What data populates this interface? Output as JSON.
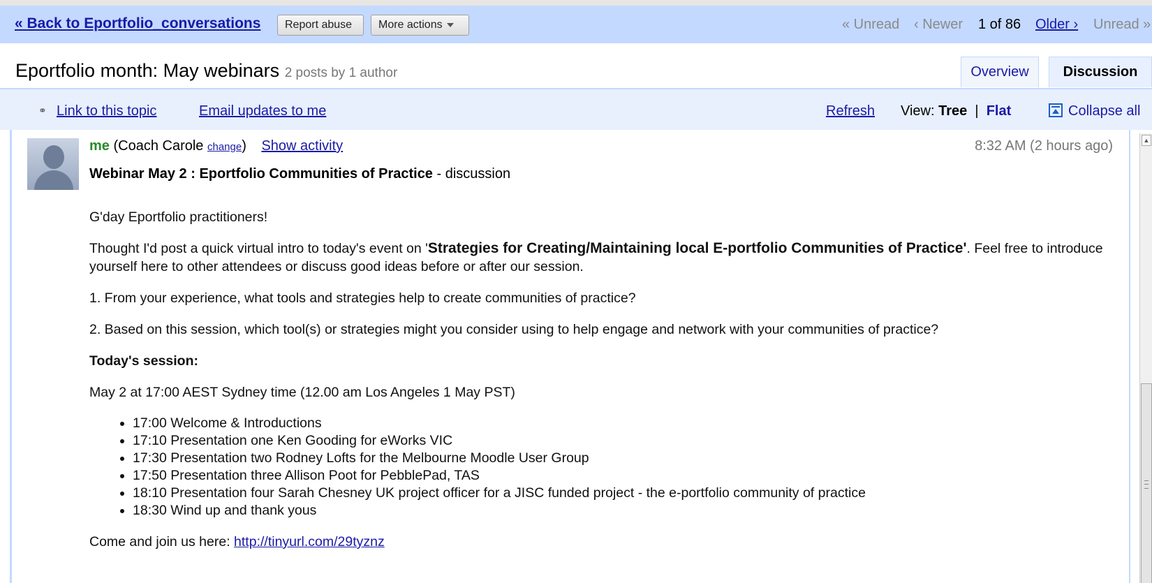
{
  "nav": {
    "back_label": "« Back to Eportfolio_conversations",
    "report_abuse": "Report abuse",
    "more_actions": "More actions",
    "unread_prev": "« Unread",
    "newer": "‹ Newer",
    "position": "1 of 86",
    "older": "Older ›",
    "unread_next": "Unread »"
  },
  "topic": {
    "title": "Eportfolio month: May webinars",
    "meta": "2 posts by 1 author",
    "tabs": [
      "Overview",
      "Discussion"
    ]
  },
  "actions": {
    "link_topic": "Link to this topic",
    "email_updates": "Email updates to me",
    "refresh": "Refresh",
    "view_label": "View:",
    "view_tree": "Tree",
    "view_sep": "|",
    "view_flat": "Flat",
    "collapse_all": "Collapse all"
  },
  "message": {
    "author_me": "me",
    "author_open": "(Coach Carole",
    "author_change": "change",
    "author_close": ")",
    "show_activity": "Show activity",
    "time": "8:32 AM (2 hours ago)",
    "subject_bold": "Webinar May 2 : Eportfolio Communities of Practice",
    "subject_rest": " - discussion",
    "greeting": "G'day Eportfolio practitioners!",
    "intro_pre": "Thought I'd post a quick virtual intro to today's event on '",
    "intro_bold": "Strategies for Creating/Maintaining local E-portfolio Communities of Practice'",
    "intro_post": ". Feel free to introduce yourself here to other attendees or discuss good ideas before or after our session.",
    "q1": "1. From your experience, what tools and strategies help to create communities of practice?",
    "q2": "2. Based on this session, which tool(s) or strategies might you consider using to help engage and network with your communities of practice?",
    "session_heading": "Today's session:",
    "session_time": "May 2 at 17:00 AEST Sydney time (12.00 am Los Angeles 1 May PST)",
    "agenda": [
      "17:00 Welcome & Introductions",
      "17:10 Presentation one Ken Gooding for eWorks VIC",
      "17:30 Presentation two Rodney Lofts for the Melbourne Moodle User Group",
      "17:50 Presentation three Allison Poot for PebblePad, TAS",
      "18:10 Presentation four Sarah Chesney UK project officer for a JISC funded project - the e-portfolio community of practice",
      "18:30 Wind up and thank yous"
    ],
    "join_pre": "Come and join us here: ",
    "join_link": "http://tinyurl.com/29tyznz"
  }
}
